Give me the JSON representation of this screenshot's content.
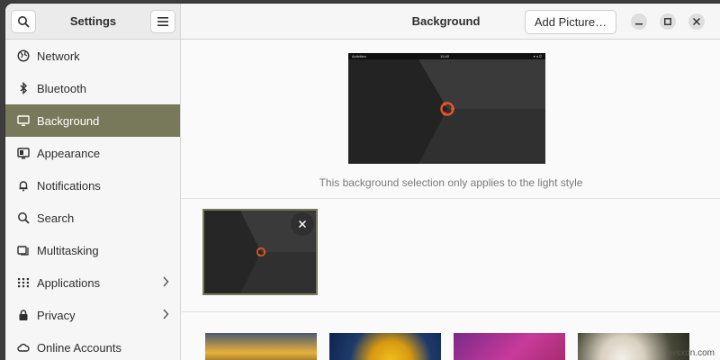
{
  "app": {
    "title": "Settings",
    "page_title": "Background"
  },
  "header": {
    "search_icon": "search-icon",
    "menu_icon": "hamburger-menu-icon",
    "add_picture_label": "Add Picture…"
  },
  "sidebar": {
    "items": [
      {
        "label": "Network",
        "icon": "network-globe-icon",
        "active": false,
        "chevron": false
      },
      {
        "label": "Bluetooth",
        "icon": "bluetooth-icon",
        "active": false,
        "chevron": false
      },
      {
        "label": "Background",
        "icon": "monitor-icon",
        "active": true,
        "chevron": false
      },
      {
        "label": "Appearance",
        "icon": "appearance-icon",
        "active": false,
        "chevron": false
      },
      {
        "label": "Notifications",
        "icon": "bell-icon",
        "active": false,
        "chevron": false
      },
      {
        "label": "Search",
        "icon": "search-icon",
        "active": false,
        "chevron": false
      },
      {
        "label": "Multitasking",
        "icon": "multitasking-icon",
        "active": false,
        "chevron": false
      },
      {
        "label": "Applications",
        "icon": "grid-icon",
        "active": false,
        "chevron": true
      },
      {
        "label": "Privacy",
        "icon": "lock-icon",
        "active": false,
        "chevron": true
      },
      {
        "label": "Online Accounts",
        "icon": "cloud-icon",
        "active": false,
        "chevron": false
      }
    ]
  },
  "preview": {
    "topbar_left": "Activities",
    "topbar_center": "15:40",
    "hint": "This background selection only applies to the light style"
  },
  "colors": {
    "accent": "#78785a",
    "ubuntu_orange": "#e95420"
  },
  "watermark": "wsxdn.com"
}
